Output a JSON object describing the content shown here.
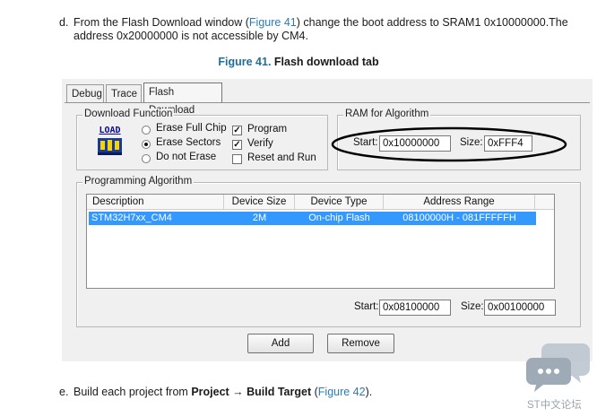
{
  "step_d": {
    "marker": "d.",
    "line1_a": "From the Flash Download window (",
    "line1_link": "Figure 41",
    "line1_b": ") change the boot address to SRAM1 0x10000000.The",
    "line2": "address 0x20000000 is not accessible by CM4."
  },
  "figure": {
    "number": "Figure 41.",
    "title": "Flash download tab"
  },
  "dialog": {
    "tabs": [
      "Debug",
      "Trace",
      "Flash Download"
    ],
    "active_tab": 2,
    "download_function": {
      "legend": "Download Function",
      "load_icon_text": "LOAD",
      "radios": [
        {
          "label": "Erase Full Chip",
          "selected": false
        },
        {
          "label": "Erase Sectors",
          "selected": true
        },
        {
          "label": "Do not Erase",
          "selected": false
        }
      ],
      "checks": [
        {
          "label": "Program",
          "checked": true,
          "mark": "✓"
        },
        {
          "label": "Verify",
          "checked": true,
          "mark": "✓"
        },
        {
          "label": "Reset and Run",
          "checked": false,
          "mark": ""
        }
      ]
    },
    "ram": {
      "legend": "RAM for Algorithm",
      "start_label": "Start:",
      "start_value": "0x10000000",
      "size_label": "Size:",
      "size_value": "0xFFF4"
    },
    "programming": {
      "legend": "Programming Algorithm",
      "columns": [
        "Description",
        "Device Size",
        "Device Type",
        "Address Range"
      ],
      "rows": [
        {
          "description": "STM32H7xx_CM4",
          "size": "2M",
          "type": "On-chip Flash",
          "range": "08100000H - 081FFFFFH"
        }
      ],
      "start_label": "Start:",
      "start_value": "0x08100000",
      "size_label": "Size:",
      "size_value": "0x00100000"
    },
    "buttons": {
      "add": "Add",
      "remove": "Remove"
    }
  },
  "step_e": {
    "marker": "e.",
    "text_a": "Build each project from ",
    "bold": "Project → Build Target",
    "text_b": " (",
    "link": "Figure 42",
    "text_c": ")."
  },
  "watermark": {
    "text": "ST中文论坛"
  },
  "colors": {
    "link": "#2b7bb9",
    "caption": "#1f6f97",
    "selection": "#3399ff",
    "window": "#f0f0f0"
  }
}
